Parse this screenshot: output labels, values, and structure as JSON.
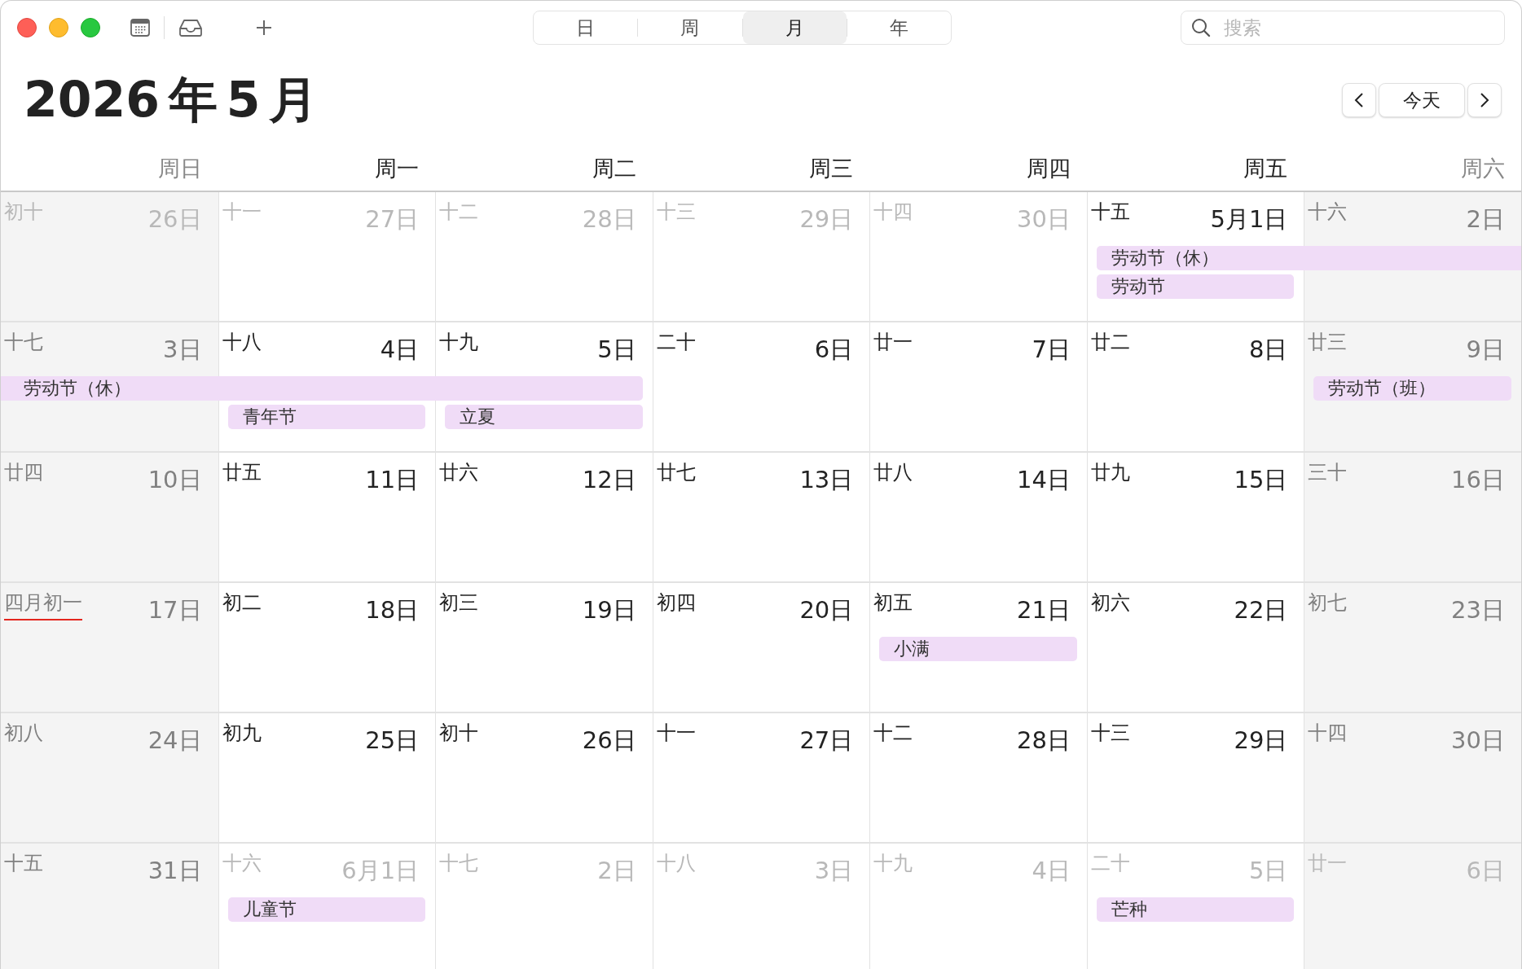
{
  "toolbar": {
    "views": [
      {
        "label": "日",
        "selected": false
      },
      {
        "label": "周",
        "selected": false
      },
      {
        "label": "月",
        "selected": true
      },
      {
        "label": "年",
        "selected": false
      }
    ],
    "search": {
      "placeholder": "搜索"
    }
  },
  "title": "2026 年 5 月",
  "navigation": {
    "today": "今天"
  },
  "weekdays": [
    {
      "label": "周日",
      "weekend": true
    },
    {
      "label": "周一",
      "weekend": false
    },
    {
      "label": "周二",
      "weekend": false
    },
    {
      "label": "周三",
      "weekend": false
    },
    {
      "label": "周四",
      "weekend": false
    },
    {
      "label": "周五",
      "weekend": false
    },
    {
      "label": "周六",
      "weekend": true
    }
  ],
  "weeks": [
    {
      "days": [
        {
          "lunar": "初十",
          "date": "26日",
          "outside_month": true
        },
        {
          "lunar": "十一",
          "date": "27日",
          "outside_month": true
        },
        {
          "lunar": "十二",
          "date": "28日",
          "outside_month": true
        },
        {
          "lunar": "十三",
          "date": "29日",
          "outside_month": true
        },
        {
          "lunar": "十四",
          "date": "30日",
          "outside_month": true
        },
        {
          "lunar": "十五",
          "date": "5月1日",
          "outside_month": false,
          "events": [
            {
              "kind": "event",
              "title": "劳动节（休）",
              "continues_before": false,
              "continues_after": true
            },
            {
              "kind": "event",
              "title": "劳动节",
              "continues_before": false,
              "continues_after": false
            }
          ]
        },
        {
          "lunar": "十六",
          "date": "2日",
          "outside_month": false,
          "events": [
            {
              "kind": "continuation"
            }
          ]
        }
      ]
    },
    {
      "days": [
        {
          "lunar": "十七",
          "date": "3日",
          "outside_month": false,
          "events": [
            {
              "kind": "event",
              "title": "劳动节（休）",
              "continues_before": true,
              "continues_after": false
            }
          ]
        },
        {
          "lunar": "十八",
          "date": "4日",
          "outside_month": false,
          "events": [
            {
              "kind": "continuation"
            },
            {
              "kind": "event",
              "title": "青年节",
              "continues_before": false,
              "continues_after": false
            }
          ]
        },
        {
          "lunar": "十九",
          "date": "5日",
          "outside_month": false,
          "events": [
            {
              "kind": "continuation"
            },
            {
              "kind": "event",
              "title": "立夏",
              "continues_before": false,
              "continues_after": false
            }
          ]
        },
        {
          "lunar": "二十",
          "date": "6日",
          "outside_month": false
        },
        {
          "lunar": "廿一",
          "date": "7日",
          "outside_month": false
        },
        {
          "lunar": "廿二",
          "date": "8日",
          "outside_month": false
        },
        {
          "lunar": "廿三",
          "date": "9日",
          "outside_month": false,
          "events": [
            {
              "kind": "event",
              "title": "劳动节（班）",
              "continues_before": false,
              "continues_after": false
            }
          ]
        }
      ]
    },
    {
      "days": [
        {
          "lunar": "廿四",
          "date": "10日",
          "outside_month": false
        },
        {
          "lunar": "廿五",
          "date": "11日",
          "outside_month": false
        },
        {
          "lunar": "廿六",
          "date": "12日",
          "outside_month": false
        },
        {
          "lunar": "廿七",
          "date": "13日",
          "outside_month": false
        },
        {
          "lunar": "廿八",
          "date": "14日",
          "outside_month": false
        },
        {
          "lunar": "廿九",
          "date": "15日",
          "outside_month": false
        },
        {
          "lunar": "三十",
          "date": "16日",
          "outside_month": false
        }
      ]
    },
    {
      "days": [
        {
          "lunar": "四月初一",
          "date": "17日",
          "outside_month": false,
          "underlined": true
        },
        {
          "lunar": "初二",
          "date": "18日",
          "outside_month": false
        },
        {
          "lunar": "初三",
          "date": "19日",
          "outside_month": false
        },
        {
          "lunar": "初四",
          "date": "20日",
          "outside_month": false
        },
        {
          "lunar": "初五",
          "date": "21日",
          "outside_month": false,
          "events": [
            {
              "kind": "event",
              "title": "小满",
              "continues_before": false,
              "continues_after": false
            }
          ]
        },
        {
          "lunar": "初六",
          "date": "22日",
          "outside_month": false
        },
        {
          "lunar": "初七",
          "date": "23日",
          "outside_month": false
        }
      ]
    },
    {
      "days": [
        {
          "lunar": "初八",
          "date": "24日",
          "outside_month": false
        },
        {
          "lunar": "初九",
          "date": "25日",
          "outside_month": false
        },
        {
          "lunar": "初十",
          "date": "26日",
          "outside_month": false
        },
        {
          "lunar": "十一",
          "date": "27日",
          "outside_month": false
        },
        {
          "lunar": "十二",
          "date": "28日",
          "outside_month": false
        },
        {
          "lunar": "十三",
          "date": "29日",
          "outside_month": false
        },
        {
          "lunar": "十四",
          "date": "30日",
          "outside_month": false
        }
      ]
    },
    {
      "days": [
        {
          "lunar": "十五",
          "date": "31日",
          "outside_month": false
        },
        {
          "lunar": "十六",
          "date": "6月1日",
          "outside_month": true,
          "events": [
            {
              "kind": "event",
              "title": "儿童节",
              "continues_before": false,
              "continues_after": false
            }
          ]
        },
        {
          "lunar": "十七",
          "date": "2日",
          "outside_month": true
        },
        {
          "lunar": "十八",
          "date": "3日",
          "outside_month": true
        },
        {
          "lunar": "十九",
          "date": "4日",
          "outside_month": true
        },
        {
          "lunar": "二十",
          "date": "5日",
          "outside_month": true,
          "events": [
            {
              "kind": "event",
              "title": "芒种",
              "continues_before": false,
              "continues_after": false
            }
          ]
        },
        {
          "lunar": "廿一",
          "date": "6日",
          "outside_month": true
        }
      ]
    }
  ]
}
